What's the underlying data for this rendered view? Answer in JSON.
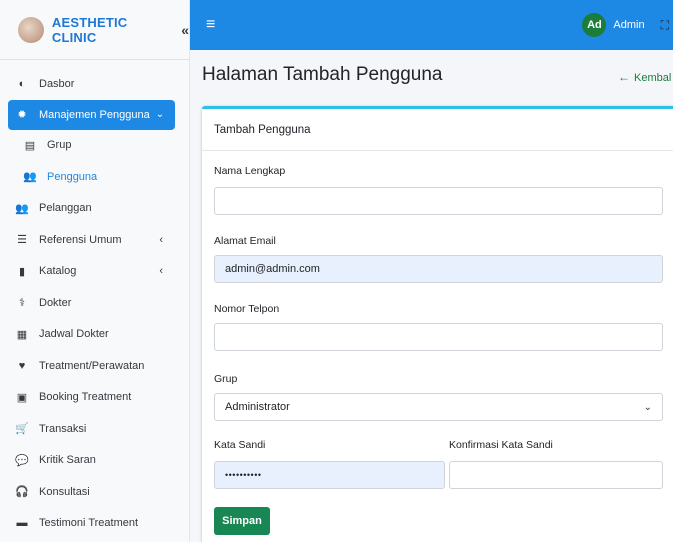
{
  "brand": {
    "name": "AESTHETIC CLINIC",
    "collapse_icon": "«"
  },
  "topbar": {
    "menu_icon": "≡",
    "avatar_initials": "Ad",
    "user_name": "Admin",
    "fullscreen_icon": "⛶"
  },
  "sidebar": {
    "items": [
      {
        "label": "Dasbor",
        "icon": "◐"
      },
      {
        "label": "Manajemen Pengguna",
        "icon": "✹",
        "chevron": "⌄"
      },
      {
        "label": "Grup",
        "icon": "▤"
      },
      {
        "label": "Pengguna",
        "icon": "👥"
      },
      {
        "label": "Pelanggan",
        "icon": "👥"
      },
      {
        "label": "Referensi Umum",
        "icon": "☰",
        "chevron": "‹"
      },
      {
        "label": "Katalog",
        "icon": "▮",
        "chevron": "‹"
      },
      {
        "label": "Dokter",
        "icon": "⚕"
      },
      {
        "label": "Jadwal Dokter",
        "icon": "▦"
      },
      {
        "label": "Treatment/Perawatan",
        "icon": "♥"
      },
      {
        "label": "Booking Treatment",
        "icon": "▣"
      },
      {
        "label": "Transaksi",
        "icon": "🛒"
      },
      {
        "label": "Kritik Saran",
        "icon": "💬"
      },
      {
        "label": "Konsultasi",
        "icon": "🎧"
      },
      {
        "label": "Testimoni Treatment",
        "icon": "▬"
      }
    ]
  },
  "page": {
    "title": "Halaman Tambah Pengguna",
    "back_label": "Kembal",
    "back_icon": "←"
  },
  "form": {
    "card_title": "Tambah Pengguna",
    "full_name": {
      "label": "Nama Lengkap",
      "value": ""
    },
    "email": {
      "label": "Alamat Email",
      "value": "admin@admin.com"
    },
    "phone": {
      "label": "Nomor Telpon",
      "value": ""
    },
    "group": {
      "label": "Grup",
      "value": "Administrator",
      "chevron": "⌄"
    },
    "password": {
      "label": "Kata Sandi",
      "value": "••••••••••"
    },
    "password_confirm": {
      "label": "Konfirmasi Kata Sandi",
      "value": ""
    },
    "submit_label": "Simpan"
  },
  "colors": {
    "primary": "#1e88e5",
    "success": "#198754",
    "card_accent": "#2bc0e4",
    "autofill": "#e8f0fe"
  }
}
